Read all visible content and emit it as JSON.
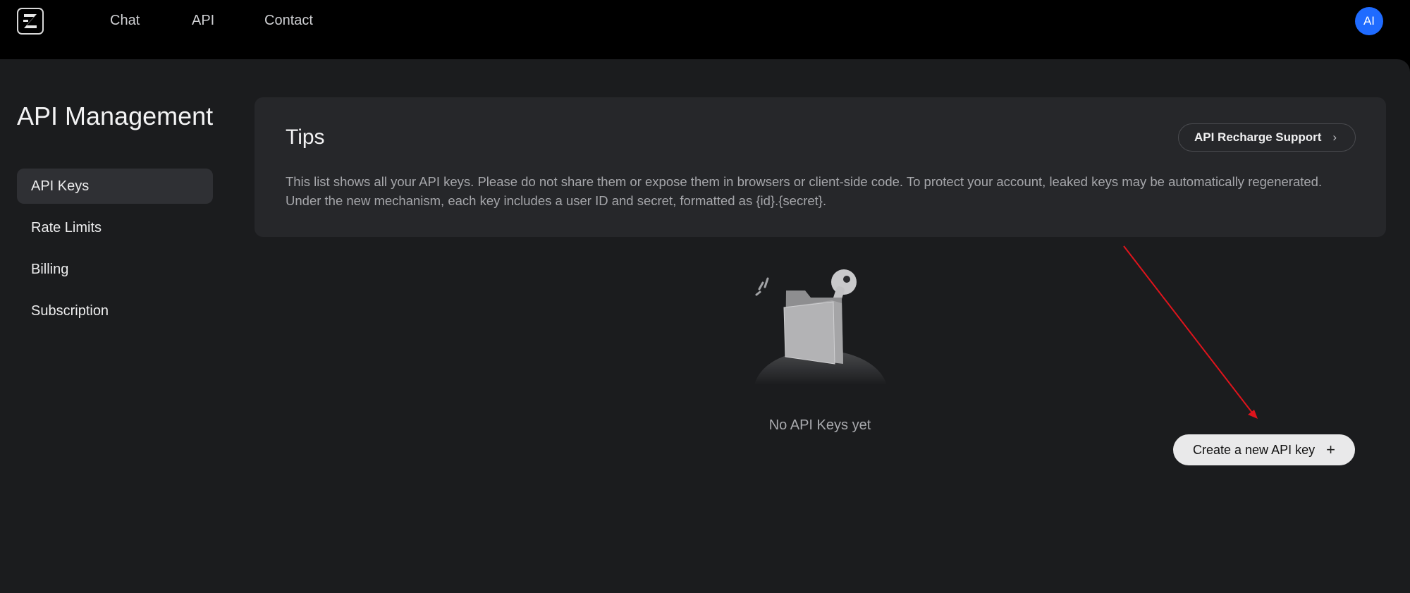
{
  "nav": {
    "logo_icon": "z-logo-icon",
    "links": [
      "Chat",
      "API",
      "Contact"
    ],
    "avatar_initials": "AI"
  },
  "sidebar": {
    "title": "API Management",
    "items": [
      {
        "label": "API Keys",
        "active": true
      },
      {
        "label": "Rate Limits",
        "active": false
      },
      {
        "label": "Billing",
        "active": false
      },
      {
        "label": "Subscription",
        "active": false
      }
    ]
  },
  "tips": {
    "title": "Tips",
    "recharge_label": "API Recharge Support",
    "recharge_icon": "chevron-right-icon",
    "line1": "This list shows all your API keys. Please do not share them or expose them in browsers or client-side code. To protect your account, leaked keys may be automatically regenerated.",
    "line2": "Under the new mechanism, each key includes a user ID and secret, formatted as {id}.{secret}."
  },
  "empty_state": {
    "icon": "folder-key-icon",
    "text": "No API Keys yet"
  },
  "create_button": {
    "label": "Create a new API key",
    "icon": "plus-icon"
  },
  "colors": {
    "accent": "#1f6bff",
    "annotation_arrow": "#e0141c",
    "background": "#1b1c1e",
    "card": "#26272a"
  }
}
